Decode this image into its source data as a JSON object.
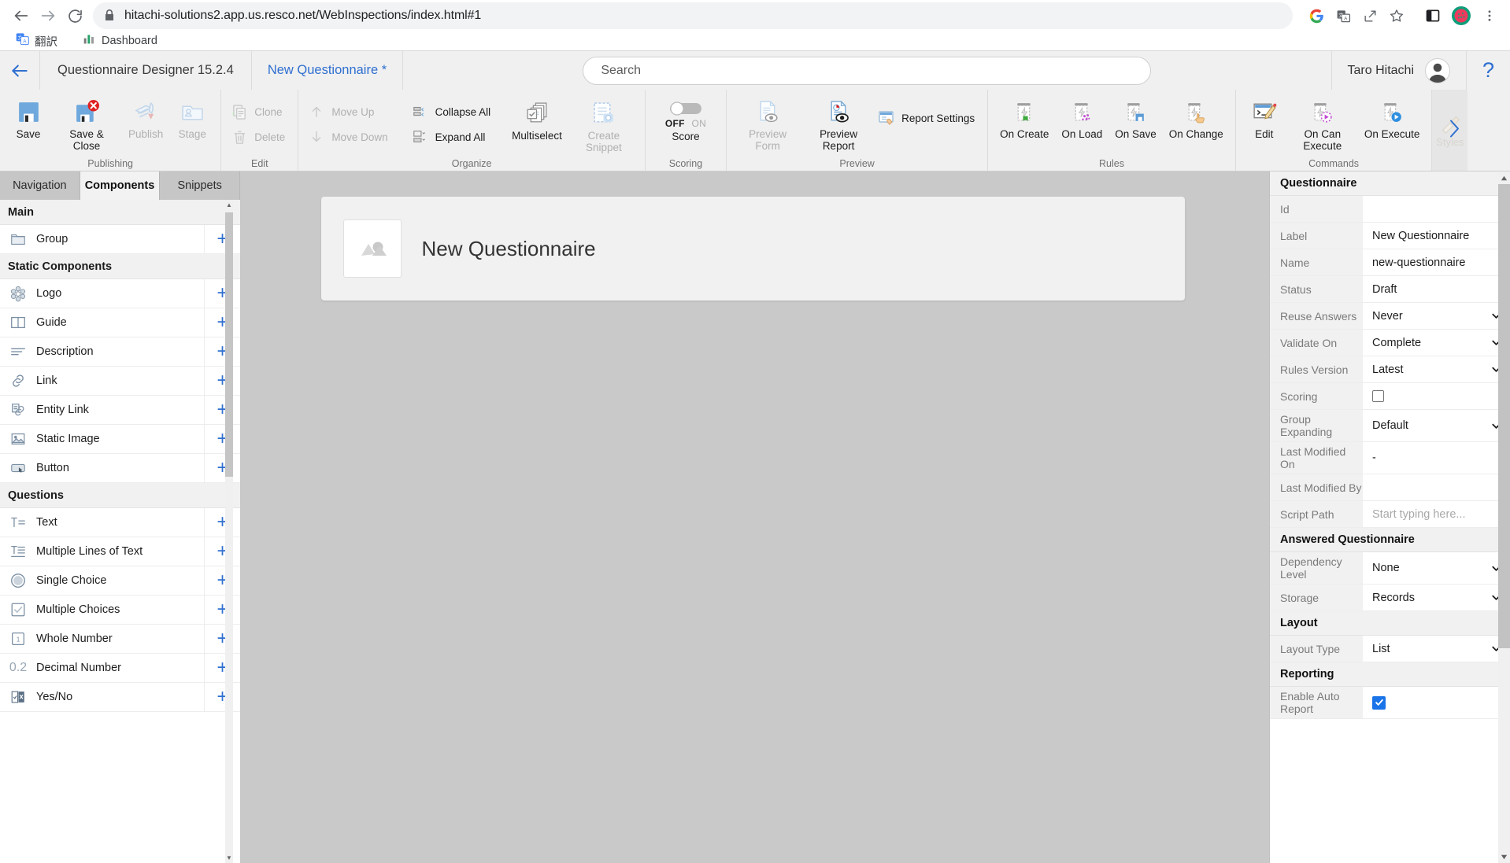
{
  "browser": {
    "url": "hitachi-solutions2.app.us.resco.net/WebInspections/index.html#1",
    "nav": {
      "back": "back-arrow-icon",
      "forward": "forward-arrow-icon",
      "reload": "reload-icon"
    },
    "bookmarks": [
      {
        "label": "翻訳",
        "icon": "translate-icon"
      },
      {
        "label": "Dashboard",
        "icon": "chart-icon"
      }
    ],
    "omni_icons": [
      "google-icon",
      "translate-page-icon",
      "share-icon",
      "bookmark-star-icon"
    ],
    "chrome_icons": [
      "side-panel-icon",
      "extension-avatar-icon",
      "kebab-menu-icon"
    ]
  },
  "app_header": {
    "back_label": "back-arrow-icon",
    "designer_title": "Questionnaire Designer 15.2.4",
    "doc_tab": "New Questionnaire *",
    "search_placeholder": "Search",
    "search_value": "",
    "user_name": "Taro Hitachi",
    "help_label": "?"
  },
  "ribbon": {
    "groups": [
      {
        "caption": "Publishing",
        "big_buttons": [
          {
            "label": "Save",
            "icon": "save-icon",
            "disabled": false
          },
          {
            "label": "Save & Close",
            "icon": "save-close-icon",
            "disabled": false
          },
          {
            "label": "Publish",
            "icon": "publish-icon",
            "disabled": true
          },
          {
            "label": "Stage",
            "icon": "stage-icon",
            "disabled": true
          }
        ]
      },
      {
        "caption": "Edit",
        "small_buttons": [
          {
            "label": "Clone",
            "icon": "clone-icon",
            "disabled": true
          },
          {
            "label": "Delete",
            "icon": "trash-icon",
            "disabled": true
          }
        ]
      },
      {
        "caption": "Organize",
        "small_columns": [
          [
            {
              "label": "Move Up",
              "icon": "arrow-up-icon",
              "disabled": true
            },
            {
              "label": "Move Down",
              "icon": "arrow-down-icon",
              "disabled": true
            }
          ],
          [
            {
              "label": "Collapse All",
              "icon": "collapse-all-icon",
              "disabled": false
            },
            {
              "label": "Expand All",
              "icon": "expand-all-icon",
              "disabled": false
            }
          ]
        ],
        "big_buttons": [
          {
            "label": "Multiselect",
            "icon": "multiselect-icon",
            "disabled": false
          },
          {
            "label": "Create Snippet",
            "icon": "create-snippet-icon",
            "disabled": true
          }
        ]
      },
      {
        "caption": "Scoring",
        "toggle": {
          "label": "Score",
          "state_off": "OFF",
          "state_on": "ON",
          "checked": false
        }
      },
      {
        "caption": "Preview",
        "big_buttons": [
          {
            "label": "Preview Form",
            "icon": "preview-form-icon",
            "disabled": true
          },
          {
            "label": "Preview Report",
            "icon": "preview-report-icon",
            "disabled": false
          }
        ],
        "small_buttons": [
          {
            "label": "Report Settings",
            "icon": "report-settings-icon",
            "disabled": false
          }
        ]
      },
      {
        "caption": "Rules",
        "big_buttons": [
          {
            "label": "On Create",
            "icon": "on-create-icon",
            "disabled": false
          },
          {
            "label": "On Load",
            "icon": "on-load-icon",
            "disabled": false
          },
          {
            "label": "On Save",
            "icon": "on-save-icon",
            "disabled": false
          },
          {
            "label": "On Change",
            "icon": "on-change-icon",
            "disabled": false
          }
        ]
      },
      {
        "caption": "Commands",
        "big_buttons": [
          {
            "label": "Edit",
            "icon": "edit-command-icon",
            "disabled": false
          },
          {
            "label": "On Can Execute",
            "icon": "on-can-execute-icon",
            "disabled": false
          },
          {
            "label": "On Execute",
            "icon": "on-execute-icon",
            "disabled": false
          }
        ]
      }
    ],
    "expand_label": "Styles",
    "expand_icon": "chevron-right-icon"
  },
  "left_panel": {
    "tabs": [
      {
        "label": "Navigation",
        "active": false
      },
      {
        "label": "Components",
        "active": true
      },
      {
        "label": "Snippets",
        "active": false
      }
    ],
    "sections": [
      {
        "title": "Main",
        "items": [
          {
            "label": "Group",
            "icon": "folder-icon"
          }
        ]
      },
      {
        "title": "Static Components",
        "items": [
          {
            "label": "Logo",
            "icon": "logo-flower-icon"
          },
          {
            "label": "Guide",
            "icon": "book-icon"
          },
          {
            "label": "Description",
            "icon": "lines-icon"
          },
          {
            "label": "Link",
            "icon": "link-icon"
          },
          {
            "label": "Entity Link",
            "icon": "entity-link-icon"
          },
          {
            "label": "Static Image",
            "icon": "image-icon"
          },
          {
            "label": "Button",
            "icon": "button-icon"
          }
        ]
      },
      {
        "title": "Questions",
        "items": [
          {
            "label": "Text",
            "icon": "text-icon"
          },
          {
            "label": "Multiple Lines of Text",
            "icon": "multiline-text-icon"
          },
          {
            "label": "Single Choice",
            "icon": "radio-icon"
          },
          {
            "label": "Multiple Choices",
            "icon": "checkbox-icon"
          },
          {
            "label": "Whole Number",
            "icon": "whole-number-icon"
          },
          {
            "label": "Decimal Number",
            "icon": "decimal-number-icon"
          },
          {
            "label": "Yes/No",
            "icon": "yesno-icon"
          }
        ]
      }
    ],
    "add_icon": "plus-icon"
  },
  "canvas": {
    "card_title": "New Questionnaire",
    "logo_icon": "logo-placeholder-icon"
  },
  "right_panel": {
    "sections": [
      {
        "title": "Questionnaire",
        "rows": [
          {
            "key": "Id",
            "value": "",
            "type": "text"
          },
          {
            "key": "Label",
            "value": "New Questionnaire",
            "type": "text"
          },
          {
            "key": "Name",
            "value": "new-questionnaire",
            "type": "text"
          },
          {
            "key": "Status",
            "value": "Draft",
            "type": "text"
          },
          {
            "key": "Reuse Answers",
            "value": "Never",
            "type": "select"
          },
          {
            "key": "Validate On",
            "value": "Complete",
            "type": "select"
          },
          {
            "key": "Rules Version",
            "value": "Latest",
            "type": "select"
          },
          {
            "key": "Scoring",
            "value": "",
            "type": "checkbox",
            "checked": false
          },
          {
            "key": "Group Expanding",
            "value": "Default",
            "type": "select"
          },
          {
            "key": "Last Modified On",
            "value": "-",
            "type": "text"
          },
          {
            "key": "Last Modified By",
            "value": "",
            "type": "text"
          },
          {
            "key": "Script Path",
            "value": "Start typing here...",
            "type": "placeholder"
          }
        ]
      },
      {
        "title": "Answered Questionnaire",
        "rows": [
          {
            "key": "Dependency Level",
            "value": "None",
            "type": "select"
          },
          {
            "key": "Storage",
            "value": "Records",
            "type": "select"
          }
        ]
      },
      {
        "title": "Layout",
        "rows": [
          {
            "key": "Layout Type",
            "value": "List",
            "type": "select"
          }
        ]
      },
      {
        "title": "Reporting",
        "rows": [
          {
            "key": "Enable Auto Report",
            "value": "",
            "type": "checkbox",
            "checked": true
          }
        ]
      }
    ]
  },
  "colors": {
    "accent_blue": "#2f6fd0",
    "ribbon_bg": "#f0f0f0",
    "canvas_bg": "#c9c9c9",
    "checkbox_checked": "#1a73e8"
  }
}
